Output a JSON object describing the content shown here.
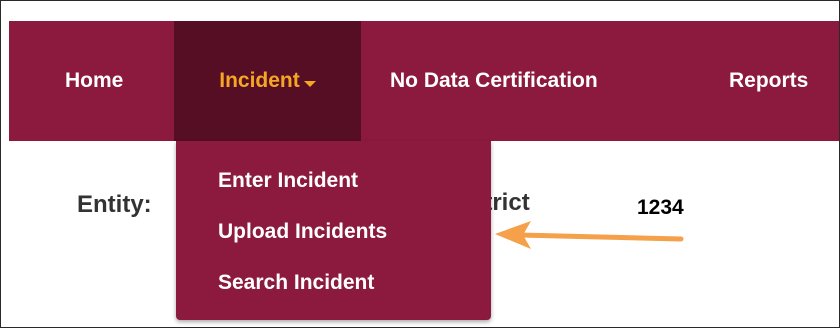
{
  "navbar": {
    "items": [
      {
        "label": "Home"
      },
      {
        "label": "Incident"
      },
      {
        "label": "No Data Certification"
      },
      {
        "label": "Reports"
      }
    ],
    "active_color": "#f5a623",
    "background": "#8c1a3e",
    "active_background": "#560e24"
  },
  "dropdown": {
    "items": [
      {
        "label": "Enter Incident"
      },
      {
        "label": "Upload Incidents"
      },
      {
        "label": "Search Incident"
      }
    ]
  },
  "entity": {
    "label": "Entity:",
    "name_partial": "strict",
    "code": "1234"
  },
  "annotation": {
    "arrow_color": "#f5a04a",
    "points_to": "Upload Incidents"
  }
}
